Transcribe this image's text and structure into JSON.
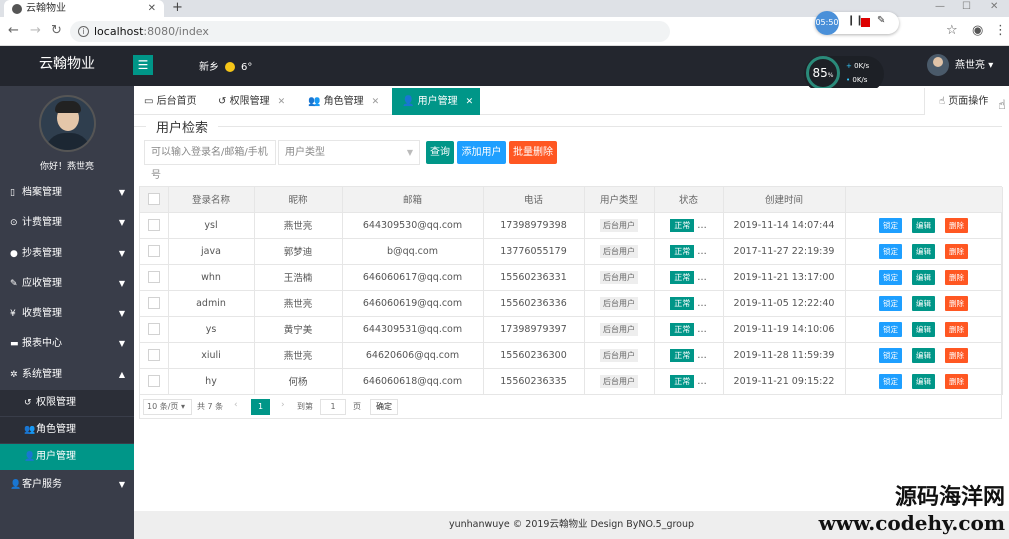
{
  "browser": {
    "tab_title": "云翰物业",
    "url_host": "localhost",
    "url_path": ":8080/index",
    "recorder_time": "05:50"
  },
  "header": {
    "logo": "云翰物业",
    "city": "新乡",
    "temperature": "6°",
    "speed_percent": "85",
    "speed_unit": "%",
    "up_rate": "0K/s",
    "down_rate": "0K/s",
    "username": "燕世亮"
  },
  "sidebar": {
    "greeting": "你好！燕世亮",
    "items": [
      {
        "label": "档案管理"
      },
      {
        "label": "计费管理"
      },
      {
        "label": "抄表管理"
      },
      {
        "label": "应收管理"
      },
      {
        "label": "收费管理"
      },
      {
        "label": "报表中心"
      },
      {
        "label": "系统管理"
      },
      {
        "label": "权限管理"
      },
      {
        "label": "角色管理"
      },
      {
        "label": "用户管理"
      },
      {
        "label": "客户服务"
      }
    ]
  },
  "tabs": [
    {
      "label": "后台首页"
    },
    {
      "label": "权限管理"
    },
    {
      "label": "角色管理"
    },
    {
      "label": "用户管理"
    }
  ],
  "page_op": "页面操作",
  "search": {
    "legend": "用户检索",
    "placeholder": "可以输入登录名/邮箱/手机号",
    "type_placeholder": "用户类型",
    "query_label": "查询",
    "add_label": "添加用户",
    "batch_delete_label": "批量删除"
  },
  "table": {
    "columns": [
      "登录名称",
      "昵称",
      "邮箱",
      "电话",
      "用户类型",
      "状态",
      "创建时间"
    ],
    "rows": [
      {
        "login": "ysl",
        "nick": "燕世亮",
        "email": "644309530@qq.com",
        "phone": "17398979398",
        "type": "后台用户",
        "status": "正常",
        "created": "2019-11-14 14:07:44"
      },
      {
        "login": "java",
        "nick": "郭梦迪",
        "email": "b@qq.com",
        "phone": "13776055179",
        "type": "后台用户",
        "status": "正常",
        "created": "2017-11-27 22:19:39"
      },
      {
        "login": "whn",
        "nick": "王浩楠",
        "email": "646060617@qq.com",
        "phone": "15560236331",
        "type": "后台用户",
        "status": "正常",
        "created": "2019-11-21 13:17:00"
      },
      {
        "login": "admin",
        "nick": "燕世亮",
        "email": "646060619@qq.com",
        "phone": "15560236336",
        "type": "后台用户",
        "status": "正常",
        "created": "2019-11-05 12:22:40"
      },
      {
        "login": "ys",
        "nick": "黄宁美",
        "email": "644309531@qq.com",
        "phone": "17398979397",
        "type": "后台用户",
        "status": "正常",
        "created": "2019-11-19 14:10:06"
      },
      {
        "login": "xiuli",
        "nick": "燕世亮",
        "email": "64620606@qq.com",
        "phone": "15560236300",
        "type": "后台用户",
        "status": "正常",
        "created": "2019-11-28 11:59:39"
      },
      {
        "login": "hy",
        "nick": "何杨",
        "email": "646060618@qq.com",
        "phone": "15560236335",
        "type": "后台用户",
        "status": "正常",
        "created": "2019-11-21 09:15:22"
      }
    ],
    "op_lock": "锁定",
    "op_edit": "编辑",
    "op_delete": "删除"
  },
  "pager": {
    "page_size": "10 条/页",
    "total": "共 7 条",
    "current": "1",
    "goto_label": "到第",
    "goto_value": "1",
    "unit": "页",
    "confirm": "确定"
  },
  "footer": "yunhanwuye © 2019云翰物业 Design ByNO.5_group",
  "watermark": {
    "line1": "源码海洋网",
    "line2": "www.codehy.com"
  },
  "colors": {
    "teal": "#009688",
    "blue": "#1e9fff",
    "orange": "#ff5722",
    "sidebar": "#393d49",
    "header": "#23262e"
  }
}
